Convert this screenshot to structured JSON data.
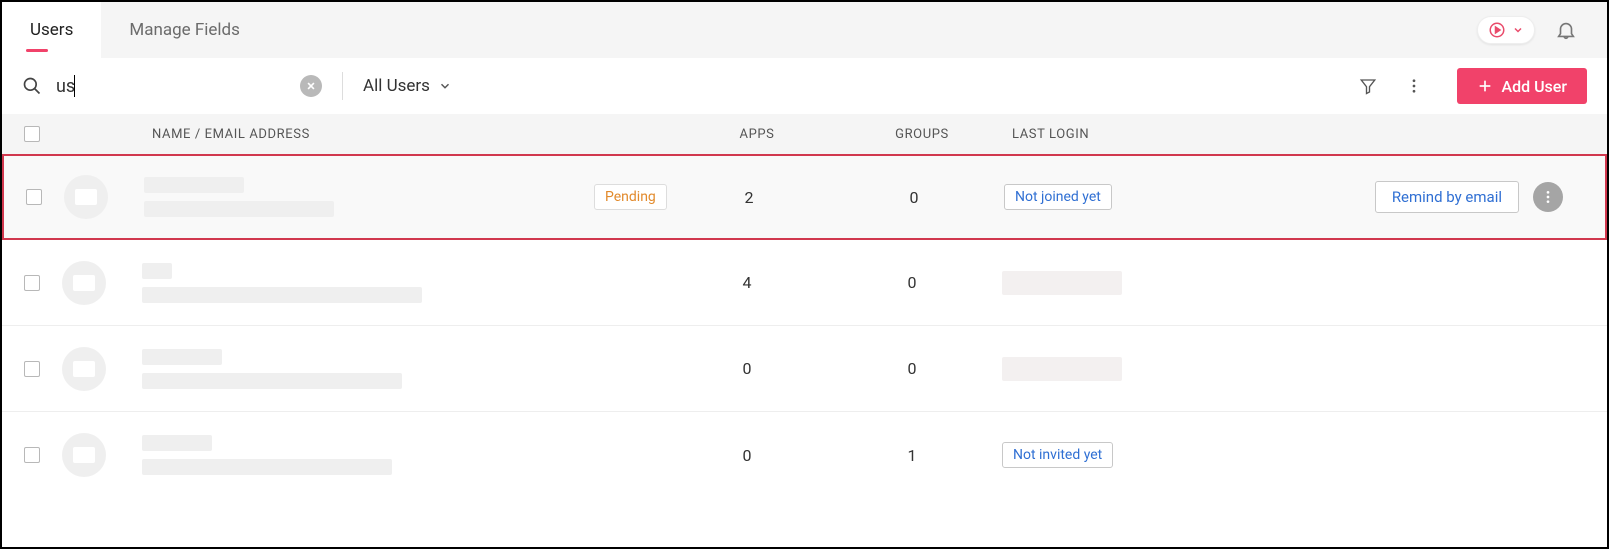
{
  "tabs": {
    "active": "Users",
    "items": [
      "Users",
      "Manage Fields"
    ]
  },
  "toolbar": {
    "search_value": "us",
    "filter_label": "All Users",
    "add_label": "Add User"
  },
  "columns": {
    "name": "NAME / EMAIL ADDRESS",
    "apps": "APPS",
    "groups": "GROUPS",
    "last_login": "LAST LOGIN"
  },
  "rows": [
    {
      "highlight": true,
      "status_badge": "Pending",
      "apps": "2",
      "groups": "0",
      "login_badge": "Not joined yet",
      "remind_label": "Remind by email",
      "show_actions": true
    },
    {
      "highlight": false,
      "status_badge": "",
      "apps": "4",
      "groups": "0",
      "login_badge": "",
      "login_placeholder": true,
      "show_actions": false
    },
    {
      "highlight": false,
      "status_badge": "",
      "apps": "0",
      "groups": "0",
      "login_badge": "",
      "login_placeholder": true,
      "show_actions": false
    },
    {
      "highlight": false,
      "status_badge": "",
      "apps": "0",
      "groups": "1",
      "login_badge": "Not invited yet",
      "show_actions": false
    }
  ]
}
